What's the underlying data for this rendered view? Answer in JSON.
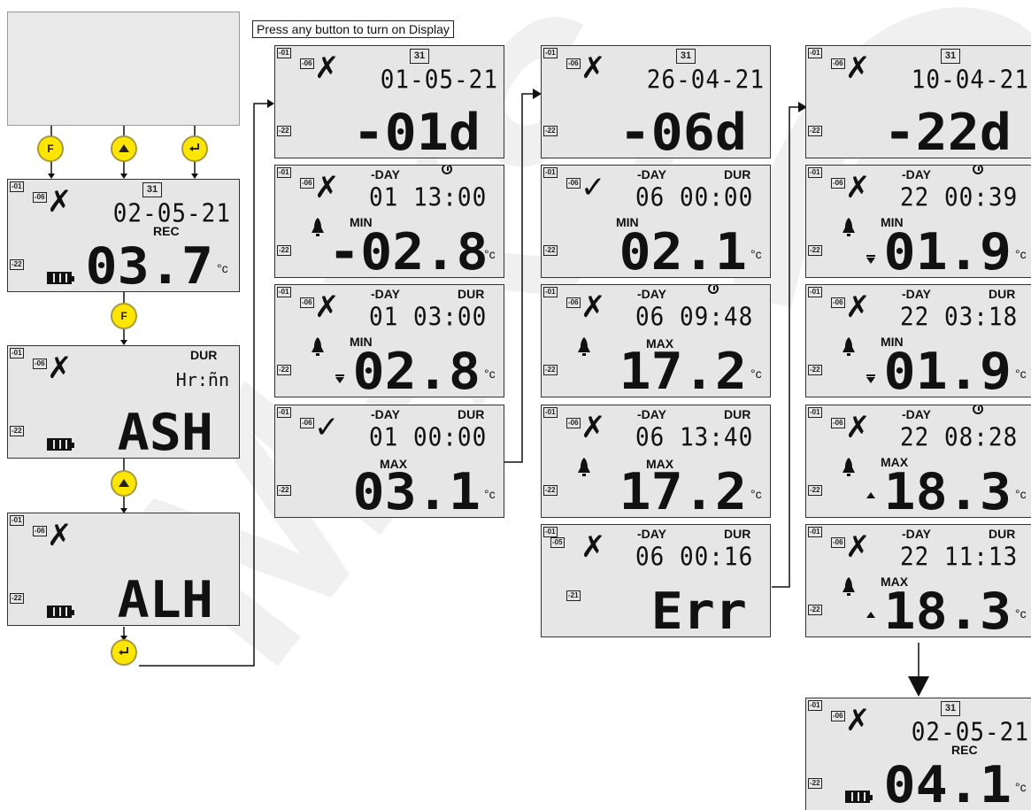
{
  "caption": "Press any button to turn on Display",
  "buttons": {
    "f": "F"
  },
  "watermark": "M-XS",
  "labels": {
    "l01": "-01",
    "l06": "-06",
    "l22": "-22",
    "l05": "-05",
    "l21": "-21"
  },
  "common": {
    "day": "-DAY",
    "dur": "DUR",
    "min": "MIN",
    "max": "MAX",
    "rec": "REC",
    "deg": "°c",
    "calendar": "31",
    "hrmin": "Hr:ñn"
  },
  "screens": [
    {
      "date": "02-05-21",
      "big": "03.7"
    },
    {
      "big": "ASH"
    },
    {
      "big": "ALH"
    },
    {
      "date": "01-05-21",
      "big": "-01d"
    },
    {
      "time": "01 13:00",
      "big": "-02.8"
    },
    {
      "time": "01 03:00",
      "big": "02.8"
    },
    {
      "time": "01 00:00",
      "big": "03.1"
    },
    {
      "date": "26-04-21",
      "big": "-06d"
    },
    {
      "time": "06 00:00",
      "big": "02.1"
    },
    {
      "time": "06 09:48",
      "big": "17.2"
    },
    {
      "time": "06 13:40",
      "big": "17.2"
    },
    {
      "time": "06 00:16",
      "big": "Err"
    },
    {
      "date": "10-04-21",
      "big": "-22d"
    },
    {
      "time": "22 00:39",
      "big": "01.9"
    },
    {
      "time": "22 03:18",
      "big": "01.9"
    },
    {
      "time": "22 08:28",
      "big": "18.3"
    },
    {
      "time": "22 11:13",
      "big": "18.3"
    },
    {
      "date": "02-05-21",
      "big": "04.1"
    }
  ]
}
